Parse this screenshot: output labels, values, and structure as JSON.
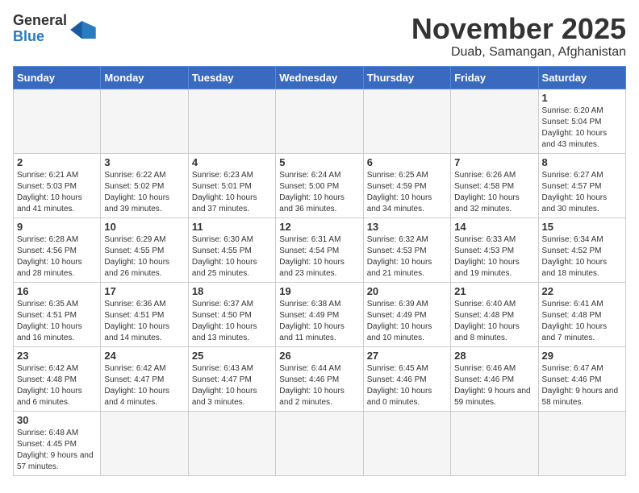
{
  "logo": {
    "text_general": "General",
    "text_blue": "Blue"
  },
  "header": {
    "month": "November 2025",
    "location": "Duab, Samangan, Afghanistan"
  },
  "weekdays": [
    "Sunday",
    "Monday",
    "Tuesday",
    "Wednesday",
    "Thursday",
    "Friday",
    "Saturday"
  ],
  "weeks": [
    [
      {
        "day": "",
        "info": ""
      },
      {
        "day": "",
        "info": ""
      },
      {
        "day": "",
        "info": ""
      },
      {
        "day": "",
        "info": ""
      },
      {
        "day": "",
        "info": ""
      },
      {
        "day": "",
        "info": ""
      },
      {
        "day": "1",
        "info": "Sunrise: 6:20 AM\nSunset: 5:04 PM\nDaylight: 10 hours and 43 minutes."
      }
    ],
    [
      {
        "day": "2",
        "info": "Sunrise: 6:21 AM\nSunset: 5:03 PM\nDaylight: 10 hours and 41 minutes."
      },
      {
        "day": "3",
        "info": "Sunrise: 6:22 AM\nSunset: 5:02 PM\nDaylight: 10 hours and 39 minutes."
      },
      {
        "day": "4",
        "info": "Sunrise: 6:23 AM\nSunset: 5:01 PM\nDaylight: 10 hours and 37 minutes."
      },
      {
        "day": "5",
        "info": "Sunrise: 6:24 AM\nSunset: 5:00 PM\nDaylight: 10 hours and 36 minutes."
      },
      {
        "day": "6",
        "info": "Sunrise: 6:25 AM\nSunset: 4:59 PM\nDaylight: 10 hours and 34 minutes."
      },
      {
        "day": "7",
        "info": "Sunrise: 6:26 AM\nSunset: 4:58 PM\nDaylight: 10 hours and 32 minutes."
      },
      {
        "day": "8",
        "info": "Sunrise: 6:27 AM\nSunset: 4:57 PM\nDaylight: 10 hours and 30 minutes."
      }
    ],
    [
      {
        "day": "9",
        "info": "Sunrise: 6:28 AM\nSunset: 4:56 PM\nDaylight: 10 hours and 28 minutes."
      },
      {
        "day": "10",
        "info": "Sunrise: 6:29 AM\nSunset: 4:55 PM\nDaylight: 10 hours and 26 minutes."
      },
      {
        "day": "11",
        "info": "Sunrise: 6:30 AM\nSunset: 4:55 PM\nDaylight: 10 hours and 25 minutes."
      },
      {
        "day": "12",
        "info": "Sunrise: 6:31 AM\nSunset: 4:54 PM\nDaylight: 10 hours and 23 minutes."
      },
      {
        "day": "13",
        "info": "Sunrise: 6:32 AM\nSunset: 4:53 PM\nDaylight: 10 hours and 21 minutes."
      },
      {
        "day": "14",
        "info": "Sunrise: 6:33 AM\nSunset: 4:53 PM\nDaylight: 10 hours and 19 minutes."
      },
      {
        "day": "15",
        "info": "Sunrise: 6:34 AM\nSunset: 4:52 PM\nDaylight: 10 hours and 18 minutes."
      }
    ],
    [
      {
        "day": "16",
        "info": "Sunrise: 6:35 AM\nSunset: 4:51 PM\nDaylight: 10 hours and 16 minutes."
      },
      {
        "day": "17",
        "info": "Sunrise: 6:36 AM\nSunset: 4:51 PM\nDaylight: 10 hours and 14 minutes."
      },
      {
        "day": "18",
        "info": "Sunrise: 6:37 AM\nSunset: 4:50 PM\nDaylight: 10 hours and 13 minutes."
      },
      {
        "day": "19",
        "info": "Sunrise: 6:38 AM\nSunset: 4:49 PM\nDaylight: 10 hours and 11 minutes."
      },
      {
        "day": "20",
        "info": "Sunrise: 6:39 AM\nSunset: 4:49 PM\nDaylight: 10 hours and 10 minutes."
      },
      {
        "day": "21",
        "info": "Sunrise: 6:40 AM\nSunset: 4:48 PM\nDaylight: 10 hours and 8 minutes."
      },
      {
        "day": "22",
        "info": "Sunrise: 6:41 AM\nSunset: 4:48 PM\nDaylight: 10 hours and 7 minutes."
      }
    ],
    [
      {
        "day": "23",
        "info": "Sunrise: 6:42 AM\nSunset: 4:48 PM\nDaylight: 10 hours and 6 minutes."
      },
      {
        "day": "24",
        "info": "Sunrise: 6:42 AM\nSunset: 4:47 PM\nDaylight: 10 hours and 4 minutes."
      },
      {
        "day": "25",
        "info": "Sunrise: 6:43 AM\nSunset: 4:47 PM\nDaylight: 10 hours and 3 minutes."
      },
      {
        "day": "26",
        "info": "Sunrise: 6:44 AM\nSunset: 4:46 PM\nDaylight: 10 hours and 2 minutes."
      },
      {
        "day": "27",
        "info": "Sunrise: 6:45 AM\nSunset: 4:46 PM\nDaylight: 10 hours and 0 minutes."
      },
      {
        "day": "28",
        "info": "Sunrise: 6:46 AM\nSunset: 4:46 PM\nDaylight: 9 hours and 59 minutes."
      },
      {
        "day": "29",
        "info": "Sunrise: 6:47 AM\nSunset: 4:46 PM\nDaylight: 9 hours and 58 minutes."
      }
    ],
    [
      {
        "day": "30",
        "info": "Sunrise: 6:48 AM\nSunset: 4:45 PM\nDaylight: 9 hours and 57 minutes."
      },
      {
        "day": "",
        "info": ""
      },
      {
        "day": "",
        "info": ""
      },
      {
        "day": "",
        "info": ""
      },
      {
        "day": "",
        "info": ""
      },
      {
        "day": "",
        "info": ""
      },
      {
        "day": "",
        "info": ""
      }
    ]
  ]
}
